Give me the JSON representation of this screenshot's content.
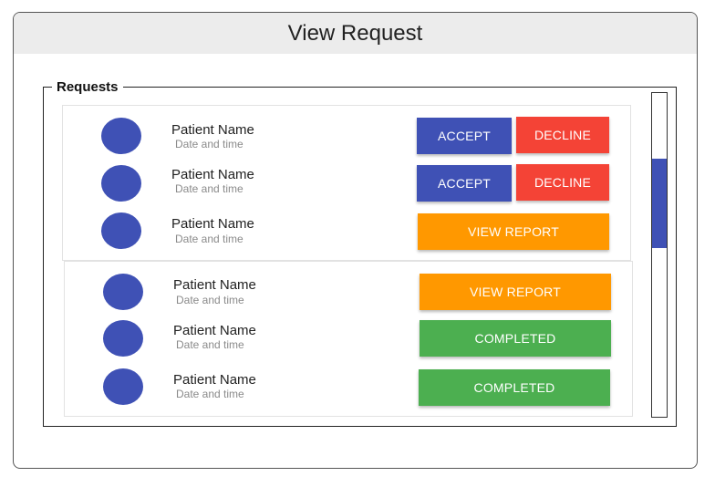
{
  "window": {
    "title": "View Request"
  },
  "requests": {
    "legend": "Requests",
    "items": [
      {
        "name": "Patient Name",
        "date": "Date and time",
        "buttons": [
          "ACCEPT",
          "DECLINE"
        ]
      },
      {
        "name": "Patient Name",
        "date": "Date and time",
        "buttons": [
          "ACCEPT",
          "DECLINE"
        ]
      },
      {
        "name": "Patient Name",
        "date": "Date and time",
        "buttons": [
          "VIEW REPORT"
        ]
      },
      {
        "name": "Patient Name",
        "date": "Date and time",
        "buttons": [
          "VIEW REPORT"
        ]
      },
      {
        "name": "Patient Name",
        "date": "Date and time",
        "buttons": [
          "COMPLETED"
        ]
      },
      {
        "name": "Patient Name",
        "date": "Date and time",
        "buttons": [
          "COMPLETED"
        ]
      }
    ]
  },
  "colors": {
    "accept": "#3f51b5",
    "decline": "#f44336",
    "view_report": "#ff9800",
    "completed": "#4caf50",
    "avatar": "#3f51b5",
    "scrollbar_thumb": "#3f51b5"
  }
}
